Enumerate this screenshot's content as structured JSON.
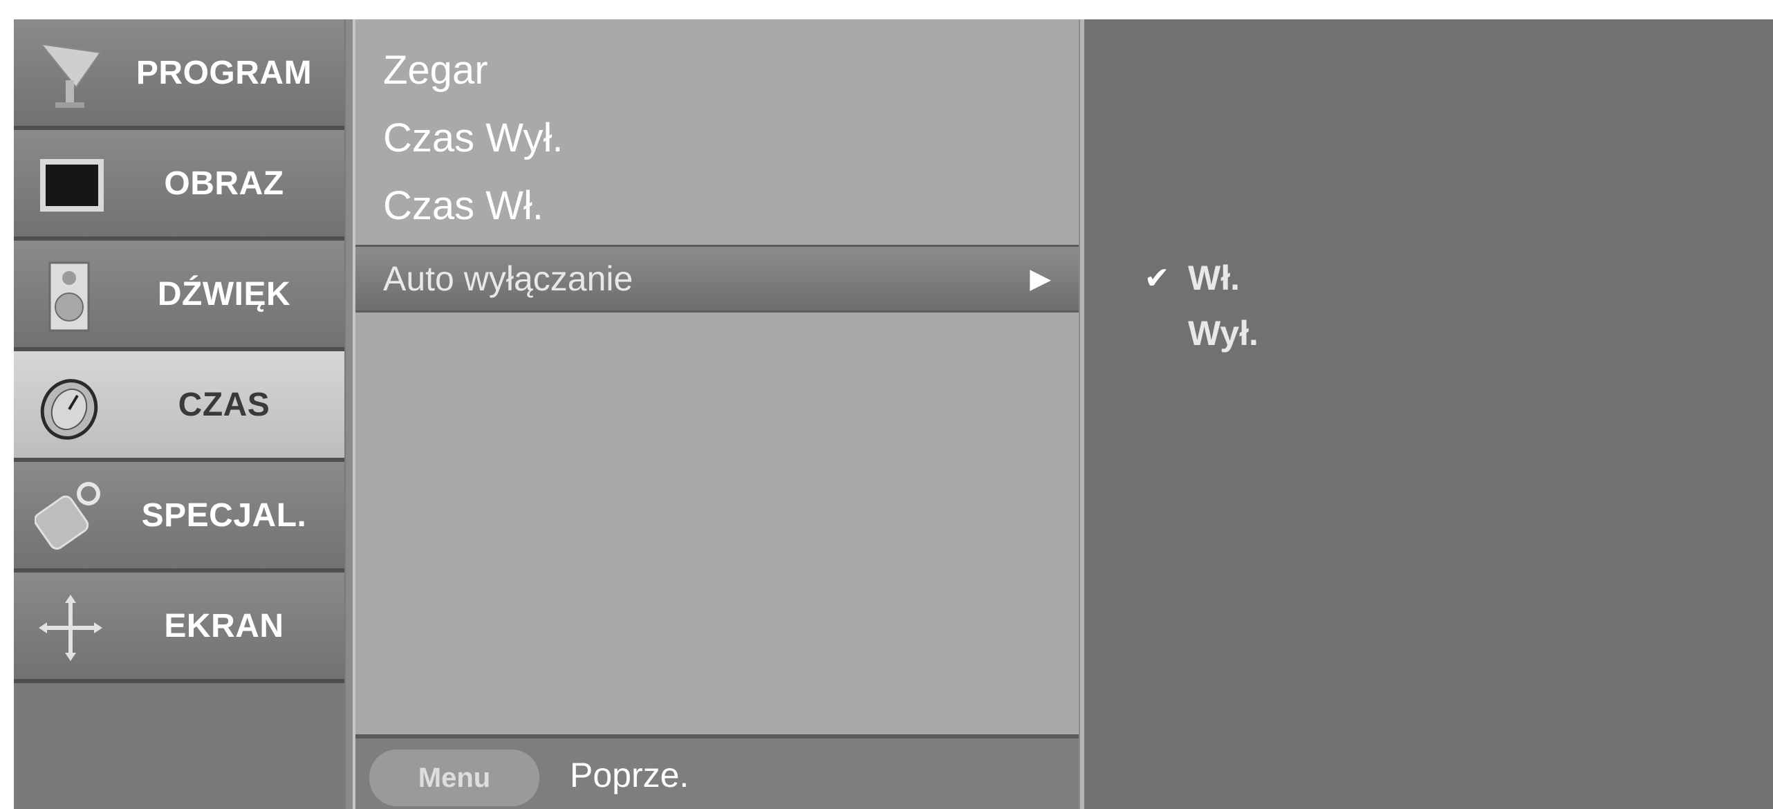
{
  "sidebar": {
    "items": [
      {
        "label": "PROGRAM",
        "icon": "satellite-dish-icon",
        "selected": false
      },
      {
        "label": "OBRAZ",
        "icon": "tv-screen-icon",
        "selected": false
      },
      {
        "label": "DŹWIĘK",
        "icon": "speaker-icon",
        "selected": false
      },
      {
        "label": "CZAS",
        "icon": "clock-icon",
        "selected": true
      },
      {
        "label": "SPECJAL.",
        "icon": "key-icon",
        "selected": false
      },
      {
        "label": "EKRAN",
        "icon": "move-arrows-icon",
        "selected": false
      }
    ]
  },
  "menu": {
    "items": [
      {
        "label": "Zegar"
      },
      {
        "label": "Czas Wył."
      },
      {
        "label": "Czas Wł."
      },
      {
        "label": "Auto wyłączanie",
        "selected": true,
        "arrow": "▶"
      }
    ],
    "footer": {
      "button_label": "Menu",
      "hint": "Poprze."
    }
  },
  "options": {
    "items": [
      {
        "label": "Wł.",
        "checked": true,
        "check": "✔"
      },
      {
        "label": "Wył.",
        "checked": false,
        "check": ""
      }
    ]
  }
}
